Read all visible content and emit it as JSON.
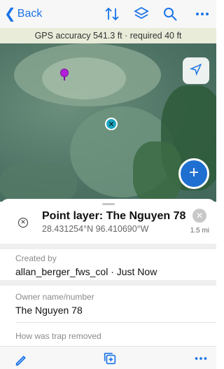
{
  "nav": {
    "back_label": "Back",
    "icons": [
      "sort-icon",
      "layers-icon",
      "search-icon",
      "more-icon"
    ]
  },
  "gps_banner": "GPS accuracy 541.3 ft · required 40 ft",
  "map": {
    "locate_icon": "locate-arrow-icon",
    "add_icon": "plus-icon"
  },
  "feature": {
    "title": "Point layer: The Nguyen 78",
    "coordinates": "28.431254°N  96.410690°W",
    "distance": "1.5 mi"
  },
  "fields": [
    {
      "label": "Created by",
      "value": "allan_berger_fws_col · Just Now"
    },
    {
      "label": "Owner name/number",
      "value": "The Nguyen 78"
    },
    {
      "label": "How was trap removed",
      "value": ""
    }
  ],
  "toolbar": {
    "icons": [
      "edit-pencil-icon",
      "copy-add-icon",
      "more-icon"
    ]
  },
  "colors": {
    "accent": "#1a73e8",
    "fab": "#1f6fd1",
    "gps_banner_bg": "#e9ecd9",
    "pin": "#b31fd9"
  }
}
